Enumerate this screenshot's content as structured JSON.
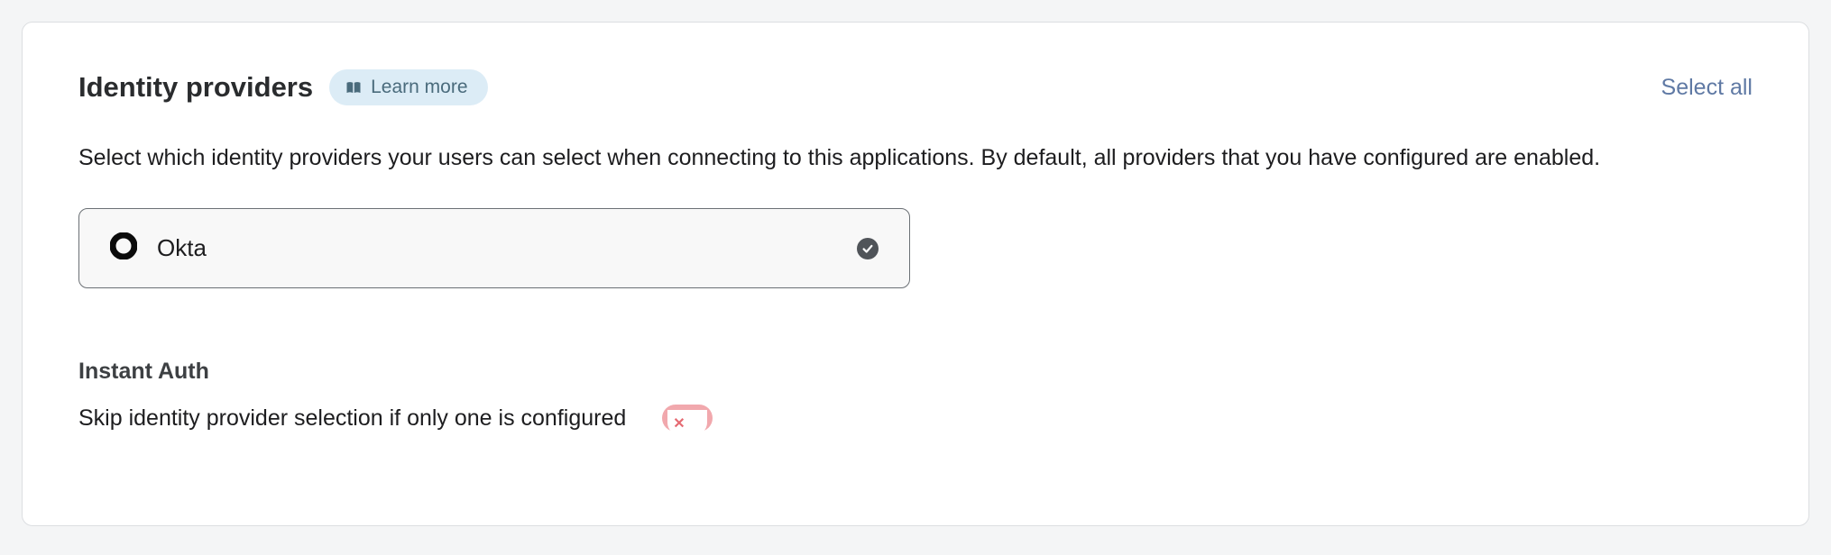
{
  "header": {
    "title": "Identity providers",
    "learn_more": "Learn more",
    "select_all": "Select all"
  },
  "description": "Select which identity providers your users can select when connecting to this applications. By default, all providers that you have configured are enabled.",
  "providers": [
    {
      "name": "Okta",
      "selected": true
    }
  ],
  "instant_auth": {
    "heading": "Instant Auth",
    "label": "Skip identity provider selection if only one is configured",
    "enabled": false
  }
}
